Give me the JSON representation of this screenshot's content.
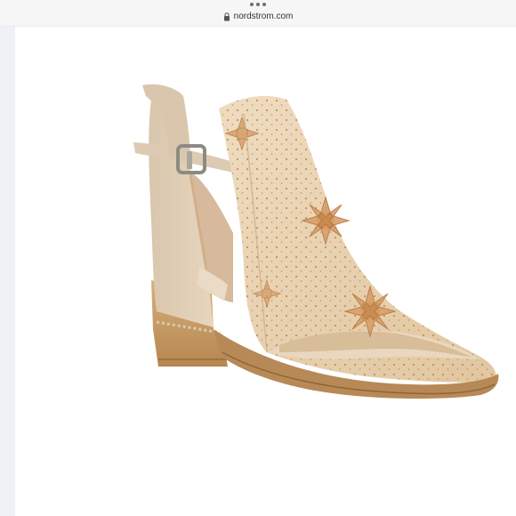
{
  "browser": {
    "url": "nordstrom.com",
    "lock_icon": "lock-icon",
    "menu_icon": "more-dots-icon"
  },
  "product": {
    "image_icon": "sandal-bootie-image",
    "colors": {
      "leather": "#e6d0b0",
      "flower": "#d8a872",
      "heel": "#c9a06a",
      "sole": "#b88957"
    }
  }
}
